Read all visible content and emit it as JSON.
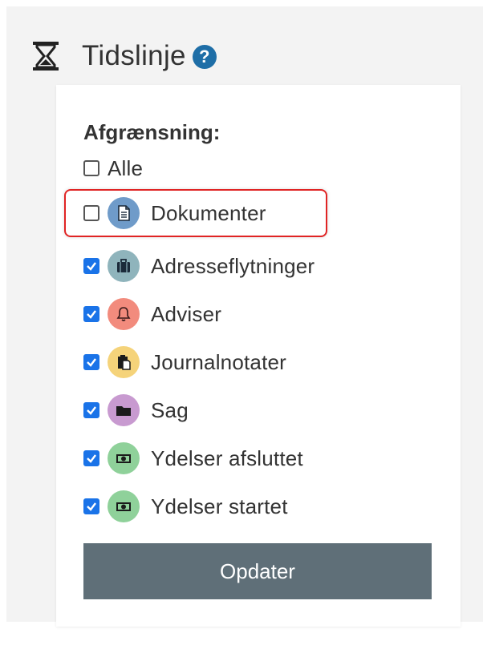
{
  "header": {
    "title": "Tidslinje",
    "help": "?"
  },
  "filter": {
    "label": "Afgrænsning:"
  },
  "items": [
    {
      "label": "Alle",
      "checked": false,
      "icon": null,
      "color": null
    },
    {
      "label": "Dokumenter",
      "checked": false,
      "icon": "document-icon",
      "color": "#6f9bc9"
    },
    {
      "label": "Adresseflytninger",
      "checked": true,
      "icon": "briefcase-icon",
      "color": "#8fb4bc"
    },
    {
      "label": "Adviser",
      "checked": true,
      "icon": "bell-icon",
      "color": "#f28b7d"
    },
    {
      "label": "Journalnotater",
      "checked": true,
      "icon": "clipboard-icon",
      "color": "#f5d37a"
    },
    {
      "label": "Sag",
      "checked": true,
      "icon": "folder-icon",
      "color": "#c89ad0"
    },
    {
      "label": "Ydelser afsluttet",
      "checked": true,
      "icon": "money-icon",
      "color": "#8fd19a"
    },
    {
      "label": "Ydelser startet",
      "checked": true,
      "icon": "money-icon",
      "color": "#8fd19a"
    }
  ],
  "update_button": {
    "label": "Opdater"
  },
  "colors": {
    "checkbox_checked": "#1a73e8",
    "button_bg": "#5f6f78",
    "highlight": "#e02424",
    "help": "#1e6ea7"
  }
}
